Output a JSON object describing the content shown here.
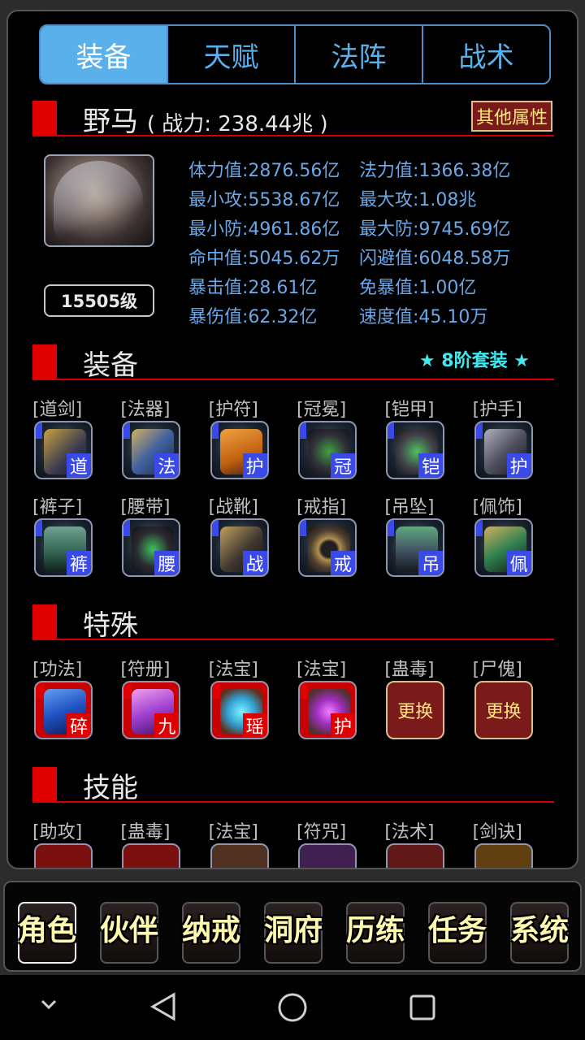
{
  "tabs": [
    "装备",
    "天赋",
    "法阵",
    "战术"
  ],
  "character": {
    "name": "野马",
    "power_label": "( 战力: 238.44兆 )",
    "other_attr_button": "其他属性",
    "level": "15505级"
  },
  "stats": [
    [
      "体力值:2876.56亿",
      "法力值:1366.38亿"
    ],
    [
      "最小攻:5538.67亿",
      "最大攻:1.08兆"
    ],
    [
      "最小防:4961.86亿",
      "最大防:9745.69亿"
    ],
    [
      "命中值:5045.62万",
      "闪避值:6048.58万"
    ],
    [
      "暴击值:28.61亿",
      "免暴值:1.00亿"
    ],
    [
      "暴伤值:62.32亿",
      "速度值:45.10万"
    ]
  ],
  "sections": {
    "equipment": "装备",
    "suit": "★ 8阶套装 ★",
    "special": "特殊",
    "skills": "技能"
  },
  "equipment": [
    {
      "label": "[道剑]",
      "tag": "道"
    },
    {
      "label": "[法器]",
      "tag": "法"
    },
    {
      "label": "[护符]",
      "tag": "护"
    },
    {
      "label": "[冠冕]",
      "tag": "冠"
    },
    {
      "label": "[铠甲]",
      "tag": "铠"
    },
    {
      "label": "[护手]",
      "tag": "护"
    },
    {
      "label": "[裤子]",
      "tag": "裤"
    },
    {
      "label": "[腰带]",
      "tag": "腰"
    },
    {
      "label": "[战靴]",
      "tag": "战"
    },
    {
      "label": "[戒指]",
      "tag": "戒"
    },
    {
      "label": "[吊坠]",
      "tag": "吊"
    },
    {
      "label": "[佩饰]",
      "tag": "佩"
    }
  ],
  "special": [
    {
      "label": "[功法]",
      "tag": "碎"
    },
    {
      "label": "[符册]",
      "tag": "九"
    },
    {
      "label": "[法宝]",
      "tag": "瑶"
    },
    {
      "label": "[法宝]",
      "tag": "护"
    },
    {
      "label": "[蛊毒]",
      "button": "更换"
    },
    {
      "label": "[尸傀]",
      "button": "更换"
    }
  ],
  "skills": [
    "[助攻]",
    "[蛊毒]",
    "[法宝]",
    "[符咒]",
    "[法术]",
    "[剑诀]"
  ],
  "bottom_nav": [
    "角色",
    "伙伴",
    "纳戒",
    "洞府",
    "历练",
    "任务",
    "系统"
  ],
  "colors": {
    "accent_blue": "#5ab0ea",
    "stat_text": "#6aa8e8",
    "section_red": "#e00000",
    "suit_cyan": "#40e8f0",
    "nav_text": "#fff8b0"
  }
}
